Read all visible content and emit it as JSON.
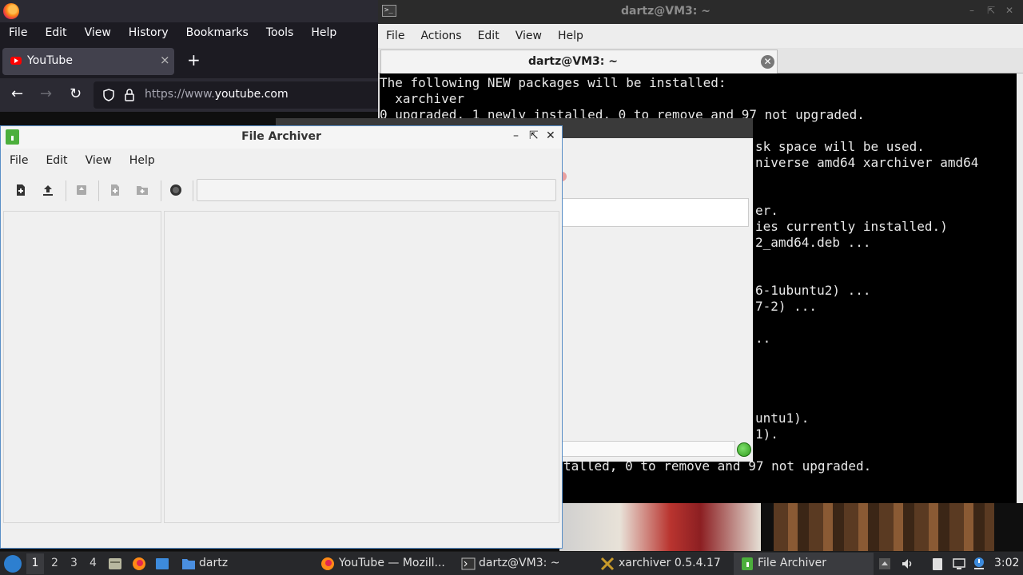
{
  "firefox": {
    "menu": [
      "File",
      "Edit",
      "View",
      "History",
      "Bookmarks",
      "Tools",
      "Help"
    ],
    "tab_title": "YouTube",
    "tab_close": "×",
    "new_tab": "+",
    "url_prefix": "https://www.",
    "url_domain": "youtube.com",
    "colors": {
      "accent": "#2b2a33",
      "youtube_red": "#ff0000"
    }
  },
  "terminal": {
    "window_title": "dartz@VM3: ~",
    "menu": [
      "File",
      "Actions",
      "Edit",
      "View",
      "Help"
    ],
    "tab_label": "dartz@VM3: ~",
    "lines": [
      "The following NEW packages will be installed:",
      "  xarchiver",
      "0 upgraded, 1 newly installed, 0 to remove and 97 not upgraded.",
      "sk space will be used.",
      "niverse amd64 xarchiver amd64",
      "er.",
      "ies currently installed.)",
      "2_amd64.deb ...",
      "6-1ubuntu2) ...",
      "7-2) ...",
      "..",
      "untu1).",
      "1).",
      "talled, 0 to remove and 97 not upgraded."
    ]
  },
  "xarchiver_bg": {
    "title": "xarchiver 0.5.4.17"
  },
  "file_archiver": {
    "title": "File Archiver",
    "menu": [
      "File",
      "Edit",
      "View",
      "Help"
    ],
    "toolbar_icons": [
      "new-archive-icon",
      "open-archive-icon",
      "extract-icon",
      "add-files-icon",
      "add-folder-icon",
      "stop-icon"
    ],
    "location": ""
  },
  "taskbar": {
    "workspaces": [
      "1",
      "2",
      "3",
      "4"
    ],
    "folder_label": "dartz",
    "tasks": [
      "YouTube — Mozill...",
      "dartz@VM3: ~",
      "xarchiver 0.5.4.17",
      "File Archiver"
    ],
    "clock": "3:02"
  }
}
